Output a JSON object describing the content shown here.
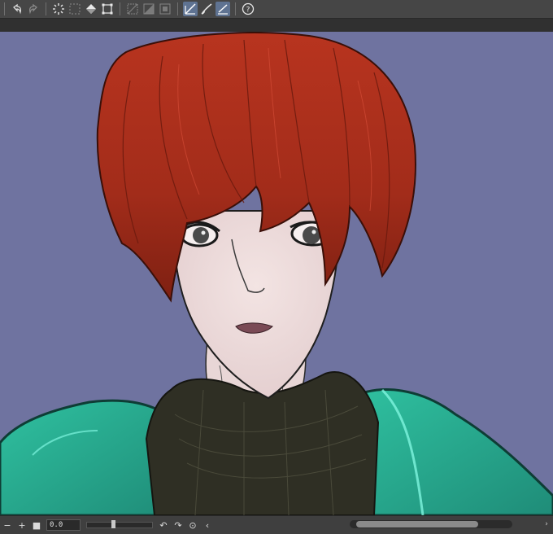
{
  "toolbar": {
    "icons": [
      "undo-icon",
      "redo-icon",
      "clear-selection-icon",
      "selection-area-icon",
      "fill-icon",
      "transform-icon",
      "ruler-icon",
      "gradient-icon",
      "frame-icon",
      "snap-ruler-icon",
      "pen-icon",
      "snap-grid-icon",
      "help-icon"
    ]
  },
  "status": {
    "zoom_value": "0.0"
  },
  "colors": {
    "canvas_bg": "#6f73a0",
    "hair": "#a8301c",
    "jacket": "#2faf95",
    "sweater": "#2e2e22",
    "skin": "#eedcdc",
    "active_tool": "#5f7392"
  }
}
